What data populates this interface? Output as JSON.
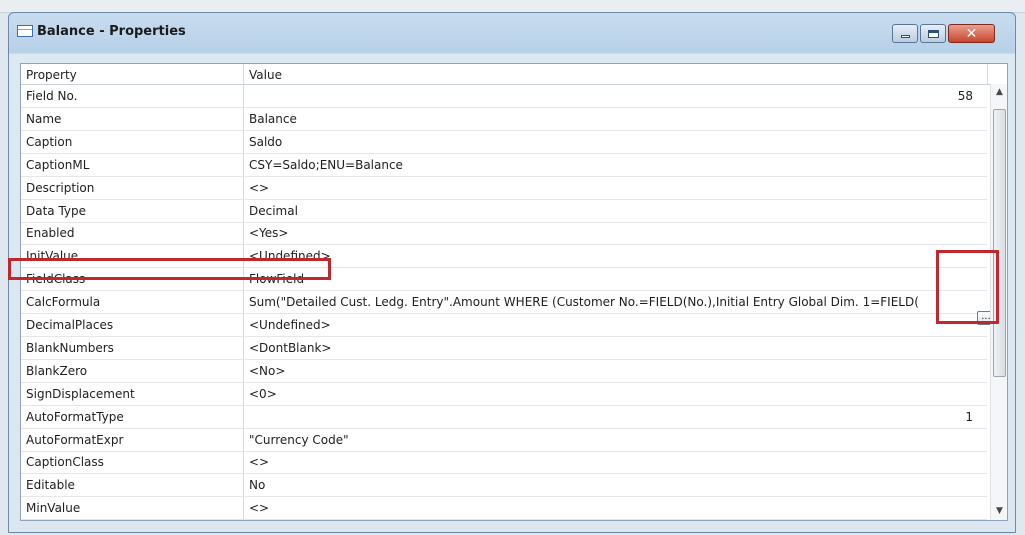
{
  "window": {
    "title": "Balance - Properties",
    "close_color": "#c8452d",
    "highlight_color": "#c0282d"
  },
  "grid": {
    "headers": {
      "property": "Property",
      "value": "Value"
    },
    "rows": [
      {
        "property": "Field No.",
        "value": "58"
      },
      {
        "property": "Name",
        "value": "Balance"
      },
      {
        "property": "Caption",
        "value": "Saldo"
      },
      {
        "property": "CaptionML",
        "value": "CSY=Saldo;ENU=Balance"
      },
      {
        "property": "Description",
        "value": "<>"
      },
      {
        "property": "Data Type",
        "value": "Decimal"
      },
      {
        "property": "Enabled",
        "value": "<Yes>"
      },
      {
        "property": "InitValue",
        "value": "<Undefined>"
      },
      {
        "property": "FieldClass",
        "value": "FlowField"
      },
      {
        "property": "CalcFormula",
        "value": "Sum(\"Detailed Cust. Ledg. Entry\".Amount WHERE (Customer No.=FIELD(No.),Initial Entry Global Dim. 1=FIELD("
      },
      {
        "property": "DecimalPlaces",
        "value": "<Undefined>"
      },
      {
        "property": "BlankNumbers",
        "value": "<DontBlank>"
      },
      {
        "property": "BlankZero",
        "value": "<No>"
      },
      {
        "property": "SignDisplacement",
        "value": "<0>"
      },
      {
        "property": "AutoFormatType",
        "value": "1"
      },
      {
        "property": "AutoFormatExpr",
        "value": "\"Currency Code\""
      },
      {
        "property": "CaptionClass",
        "value": "<>"
      },
      {
        "property": "Editable",
        "value": "No"
      },
      {
        "property": "MinValue",
        "value": "<>"
      }
    ],
    "assist_button_label": "..."
  }
}
